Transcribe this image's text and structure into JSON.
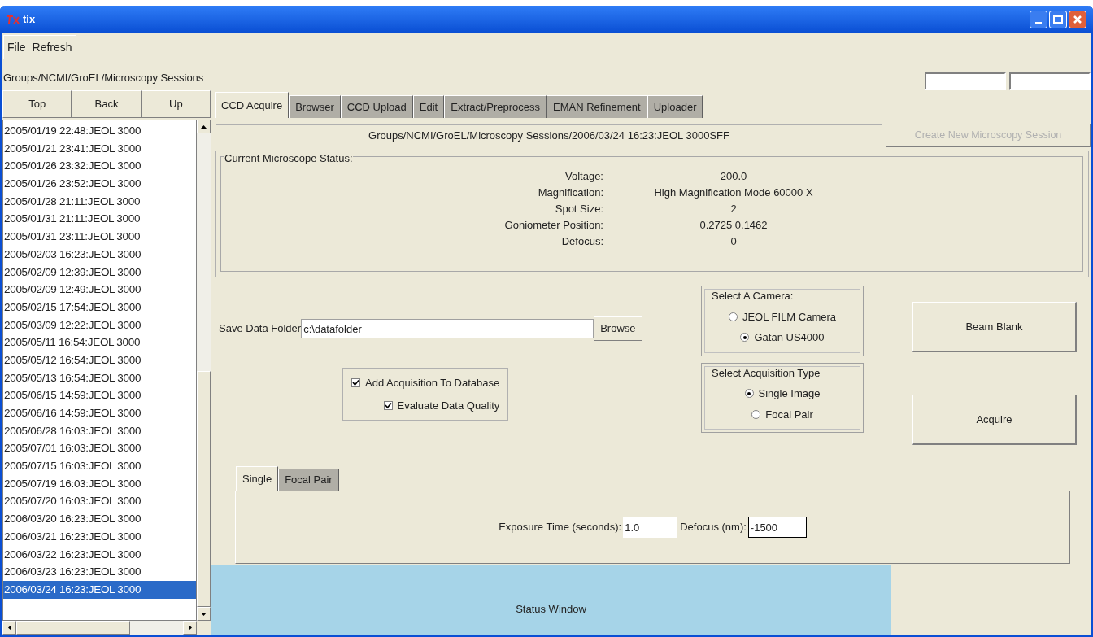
{
  "window": {
    "title": "tix"
  },
  "menu": [
    "File",
    "Refresh"
  ],
  "path": "Groups/NCMI/GroEL/Microscopy Sessions",
  "nav_buttons": [
    "Top",
    "Back",
    "Up"
  ],
  "sessions": [
    {
      "label": "2005/01/19 22:48:JEOL 3000",
      "selected": false
    },
    {
      "label": "2005/01/21 23:41:JEOL 3000",
      "selected": false
    },
    {
      "label": "2005/01/26 23:32:JEOL 3000",
      "selected": false
    },
    {
      "label": "2005/01/26 23:52:JEOL 3000",
      "selected": false
    },
    {
      "label": "2005/01/28 21:11:JEOL 3000",
      "selected": false
    },
    {
      "label": "2005/01/31 21:11:JEOL 3000",
      "selected": false
    },
    {
      "label": "2005/01/31 23:11:JEOL 3000",
      "selected": false
    },
    {
      "label": "2005/02/03 16:23:JEOL 3000",
      "selected": false
    },
    {
      "label": "2005/02/09 12:39:JEOL 3000",
      "selected": false
    },
    {
      "label": "2005/02/09 12:49:JEOL 3000",
      "selected": false
    },
    {
      "label": "2005/02/15 17:54:JEOL 3000",
      "selected": false
    },
    {
      "label": "2005/03/09 12:22:JEOL 3000",
      "selected": false
    },
    {
      "label": "2005/05/11 16:54:JEOL 3000",
      "selected": false
    },
    {
      "label": "2005/05/12 16:54:JEOL 3000",
      "selected": false
    },
    {
      "label": "2005/05/13 16:54:JEOL 3000",
      "selected": false
    },
    {
      "label": "2005/06/15 14:59:JEOL 3000",
      "selected": false
    },
    {
      "label": "2005/06/16 14:59:JEOL 3000",
      "selected": false
    },
    {
      "label": "2005/06/28 16:03:JEOL 3000",
      "selected": false
    },
    {
      "label": "2005/07/01 16:03:JEOL 3000",
      "selected": false
    },
    {
      "label": "2005/07/15 16:03:JEOL 3000",
      "selected": false
    },
    {
      "label": "2005/07/19 16:03:JEOL 3000",
      "selected": false
    },
    {
      "label": "2005/07/20 16:03:JEOL 3000",
      "selected": false
    },
    {
      "label": "2006/03/20 16:23:JEOL 3000",
      "selected": false
    },
    {
      "label": "2006/03/21 16:23:JEOL 3000",
      "selected": false
    },
    {
      "label": "2006/03/22 16:23:JEOL 3000",
      "selected": false
    },
    {
      "label": "2006/03/23 16:23:JEOL 3000",
      "selected": false
    },
    {
      "label": "2006/03/24 16:23:JEOL 3000",
      "selected": true
    }
  ],
  "tabs": [
    {
      "label": "CCD Acquire",
      "selected": true
    },
    {
      "label": "Browser",
      "selected": false
    },
    {
      "label": "CCD Upload",
      "selected": false
    },
    {
      "label": "Edit",
      "selected": false
    },
    {
      "label": "Extract/Preprocess",
      "selected": false
    },
    {
      "label": "EMAN Refinement",
      "selected": false
    },
    {
      "label": "Uploader",
      "selected": false
    }
  ],
  "session_path": "Groups/NCMI/GroEL/Microscopy Sessions/2006/03/24 16:23:JEOL 3000SFF",
  "create_button": {
    "label": "Create New Microscopy Session",
    "disabled": true
  },
  "status": {
    "title": "Current Microscope Status:",
    "rows": [
      {
        "label": "Voltage:",
        "value": "200.0"
      },
      {
        "label": "Magnification:",
        "value": "High Magnification Mode 60000 X"
      },
      {
        "label": "Spot Size:",
        "value": "2"
      },
      {
        "label": "Goniometer Position:",
        "value": "0.2725 0.1462"
      },
      {
        "label": "Defocus:",
        "value": "0"
      }
    ]
  },
  "save_folder": {
    "label": "Save Data Folder",
    "value": "c:\\datafolder",
    "button": "Browse"
  },
  "options": [
    {
      "label": "Add Acquisition To Database",
      "checked": true
    },
    {
      "label": "Evaluate Data Quality",
      "checked": true
    }
  ],
  "camera": {
    "title": "Select A Camera:",
    "options": [
      {
        "label": "JEOL FILM Camera",
        "selected": false
      },
      {
        "label": "Gatan US4000",
        "selected": true
      }
    ]
  },
  "acquisition": {
    "title": "Select Acquisition Type",
    "options": [
      {
        "label": "Single Image",
        "selected": true
      },
      {
        "label": "Focal Pair",
        "selected": false
      }
    ]
  },
  "action_buttons": [
    "Beam Blank",
    "Acquire"
  ],
  "subtabs": [
    {
      "label": "Single",
      "selected": true
    },
    {
      "label": "Focal Pair",
      "selected": false
    }
  ],
  "exposure": {
    "label": "Exposure Time (seconds):",
    "value": "1.0"
  },
  "defocus": {
    "label": "Defocus (nm):",
    "value": "-1500"
  },
  "status_window": "Status Window"
}
